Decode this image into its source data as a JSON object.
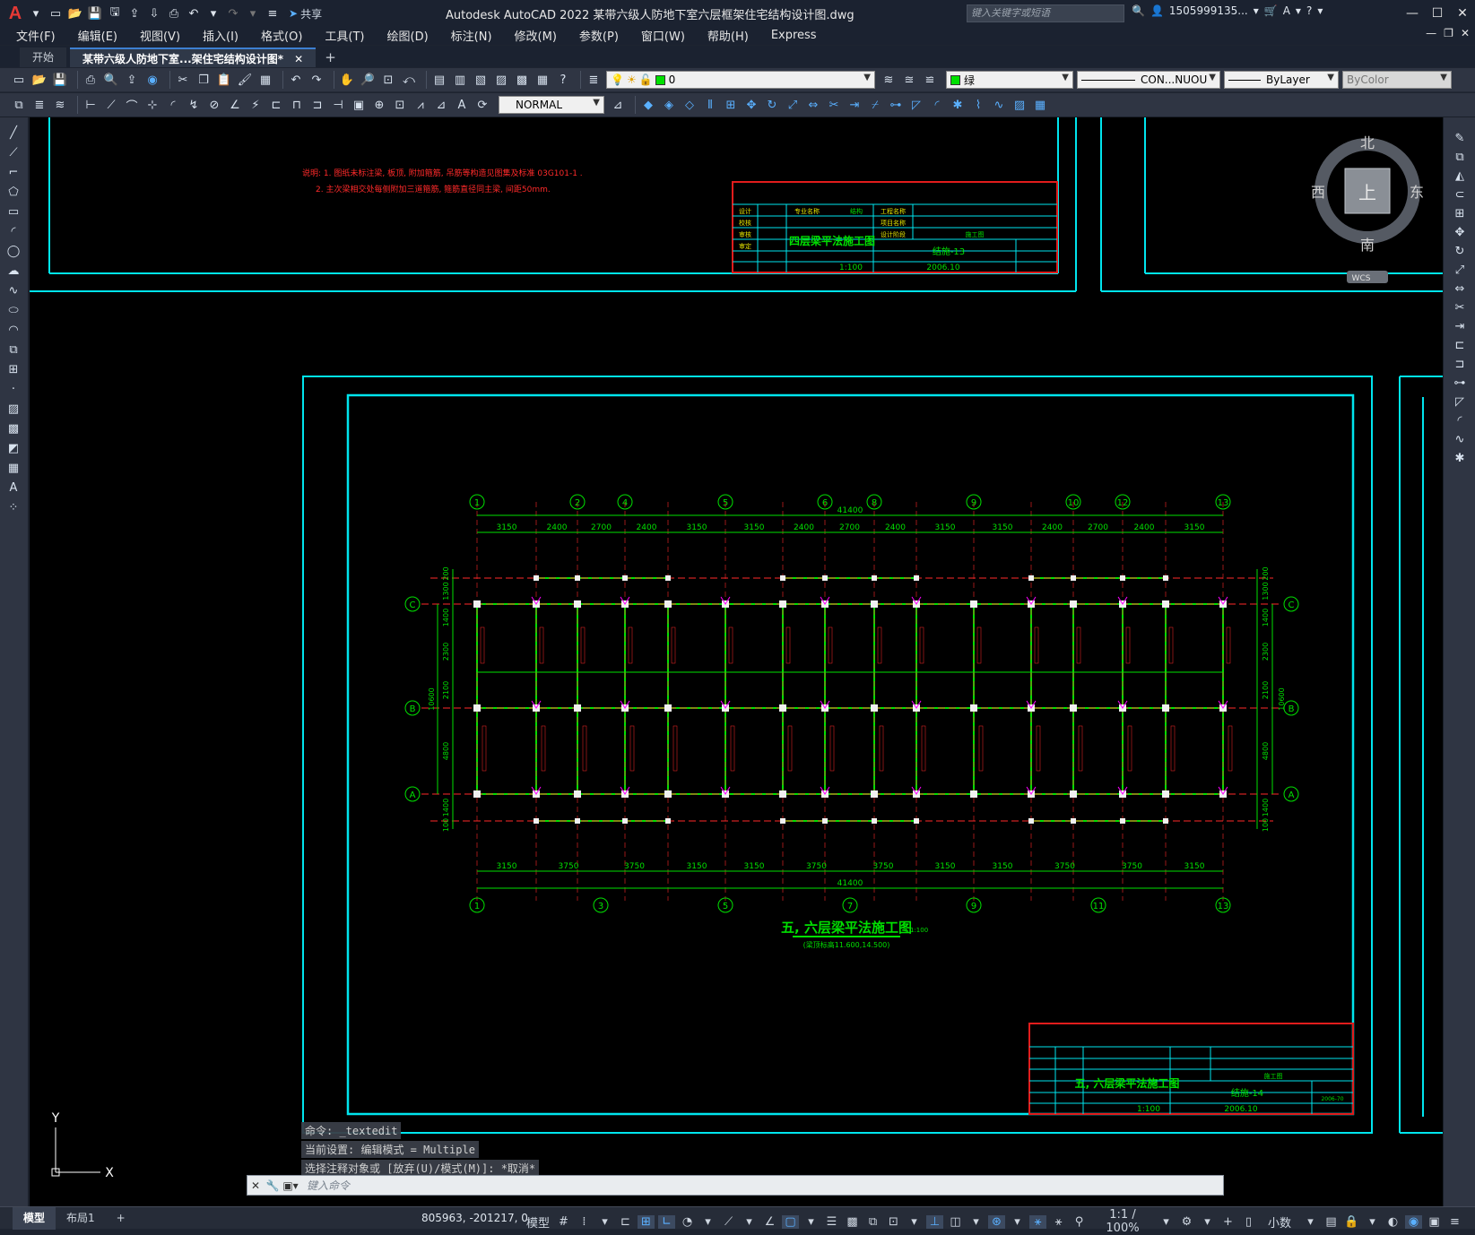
{
  "window": {
    "title": "Autodesk AutoCAD 2022    某带六级人防地下室六层框架住宅结构设计图.dwg",
    "share_label": "共享",
    "search_placeholder": "键入关键字或短语",
    "user": "1505999135...",
    "controls": [
      "—",
      "☐",
      "✕"
    ]
  },
  "menu": [
    "文件(F)",
    "编辑(E)",
    "视图(V)",
    "插入(I)",
    "格式(O)",
    "工具(T)",
    "绘图(D)",
    "标注(N)",
    "修改(M)",
    "参数(P)",
    "窗口(W)",
    "帮助(H)",
    "Express"
  ],
  "tabs": {
    "start": "开始",
    "active": "某带六级人防地下室...架住宅结构设计图*",
    "plus": "+"
  },
  "toolbar": {
    "layer_value": "0",
    "color_value": "绿",
    "linetype_value": "CON...NUOU",
    "lineweight_value": "ByLayer",
    "plotstyle_value": "ByColor",
    "dimstyle_value": "NORMAL"
  },
  "viewcube": {
    "north": "北",
    "south": "南",
    "west": "西",
    "east": "东",
    "face": "上",
    "wcs": "WCS"
  },
  "drawing": {
    "top_notes": [
      "说明: 1. 图纸未标注梁, 板顶, 附加箍筋, 吊筋等构造见图集及标准 03G101-1 .",
      "2. 主次梁相交处每侧附加三道箍筋, 箍筋直径同主梁, 间距50mm."
    ],
    "top_titleblock": {
      "drawing_name": "四层梁平法施工图",
      "sheet_no": "结施-13",
      "scale": "1:100",
      "date": "2006.10",
      "stage": "施工图",
      "rows": [
        "设计",
        "校核",
        "审核",
        "审定"
      ],
      "headers": [
        "专业名称",
        "结构",
        "工程名称",
        "项目名称",
        "设计阶段"
      ]
    },
    "plan_title": "五, 六层梁平法施工图",
    "plan_scale": "1:100",
    "plan_subtitle": "(梁顶标高11.600,14.500)",
    "top_axes": [
      "1",
      "2",
      "4",
      "5",
      "6",
      "8",
      "9",
      "10",
      "12",
      "13"
    ],
    "bottom_axes": [
      "1",
      "3",
      "5",
      "7",
      "9",
      "11",
      "13"
    ],
    "row_axes": [
      "C",
      "B",
      "A"
    ],
    "top_dims": [
      "3150",
      "2400",
      "2700",
      "2400",
      "3150",
      "3150",
      "2400",
      "2700",
      "2400",
      "3150",
      "3150",
      "2400",
      "2700",
      "2400",
      "3150"
    ],
    "bottom_dims": [
      "3150",
      "3750",
      "3750",
      "3150",
      "3150",
      "3750",
      "3750",
      "3150",
      "3150",
      "3750",
      "3750",
      "3150"
    ],
    "overall_dim": "41400",
    "left_dims": [
      "200",
      "1300",
      "1400",
      "2300",
      "2100",
      "4800",
      "1400",
      "100"
    ],
    "left_total": "10600",
    "bottom_titleblock": {
      "drawing_name": "五, 六层梁平法施工图",
      "sheet_no": "结施-14",
      "scale": "1:100",
      "date": "2006.10",
      "stage": "施工图",
      "code": "2006-70"
    },
    "ucs": {
      "x": "X",
      "y": "Y"
    }
  },
  "command": {
    "history": [
      "命令: _textedit",
      "当前设置: 编辑模式 = Multiple",
      "选择注释对象或 [放弃(U)/模式(M)]: *取消*"
    ],
    "placeholder": "键入命令"
  },
  "status": {
    "layout_tabs": [
      "模型",
      "布局1"
    ],
    "coords": "805963, -201217, 0",
    "model_label": "模型",
    "scale": "1:1 / 100%",
    "units": "小数"
  },
  "colors": {
    "frame": "#00e5ee",
    "titleblock_border": "#e11c1c",
    "beam": "#00e000",
    "text_red": "#ff2a2a",
    "column": "#f0f0f0",
    "magenta": "#ff00ff"
  }
}
